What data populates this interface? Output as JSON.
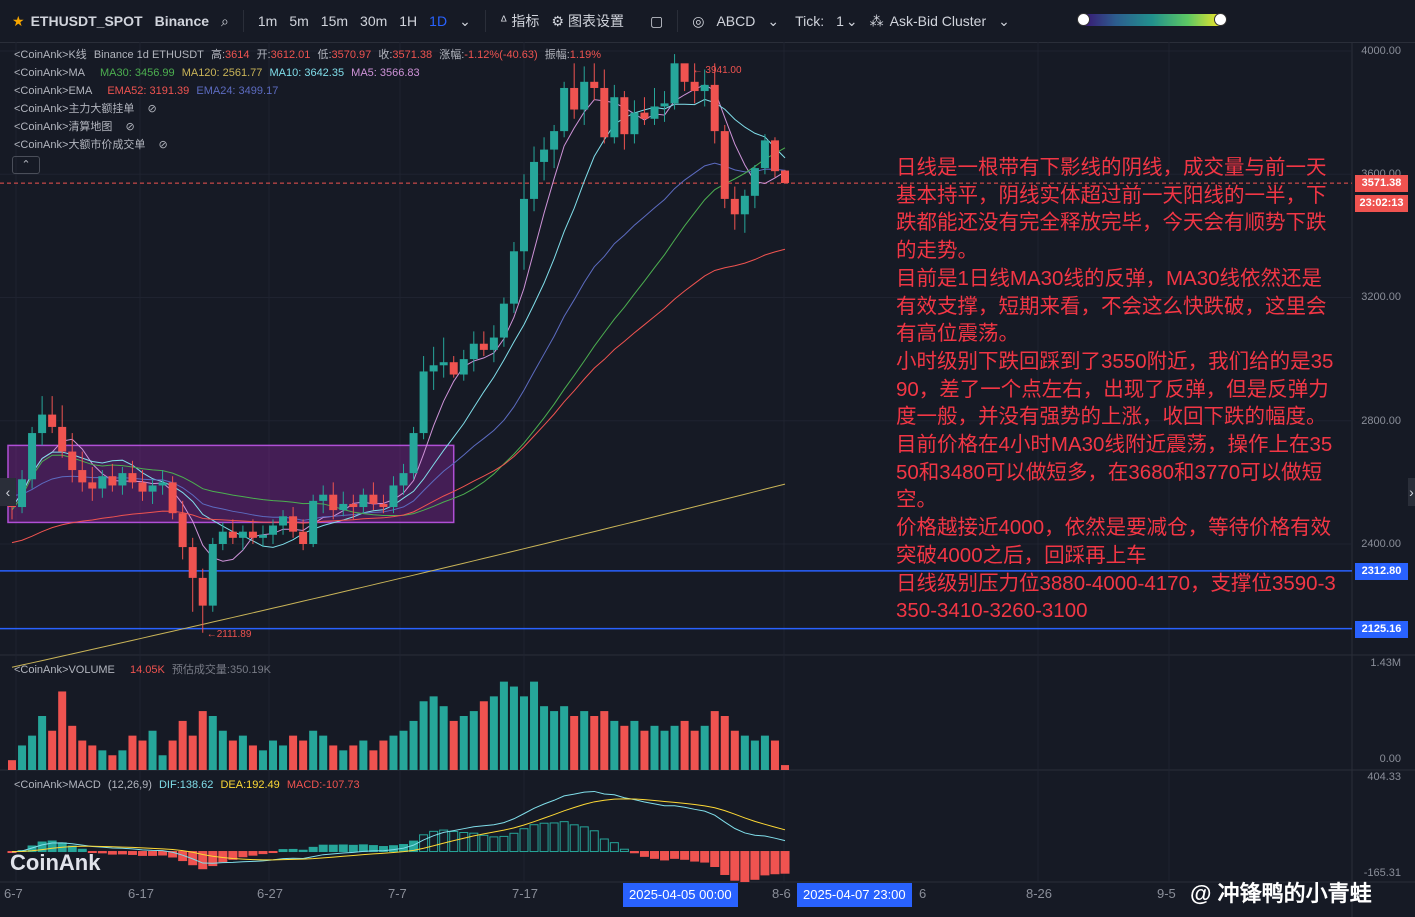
{
  "toolbar": {
    "symbol": "ETHUSDT_SPOT",
    "exchange": "Binance",
    "intervals": [
      "1m",
      "5m",
      "15m",
      "30m",
      "1H",
      "1D"
    ],
    "selected_interval": "1D",
    "indicators_label": "指标",
    "chart_settings_label": "图表设置",
    "abcd_label": "ABCD",
    "tick_label": "Tick:",
    "tick_value": "1",
    "cluster_label": "Ask-Bid Cluster"
  },
  "legend": {
    "kline": {
      "source": "<CoinAnk>",
      "name": "K线",
      "info": "Binance 1d ETHUSDT",
      "high_label": "高:",
      "high": "3614",
      "open_label": "开:",
      "open": "3612.01",
      "low_label": "低:",
      "low": "3570.97",
      "close_label": "收:",
      "close": "3571.38",
      "change_label": "涨幅:",
      "change": "-1.12%(-40.63)",
      "amp_label": "振幅:",
      "amp": "1.19%"
    },
    "ma": {
      "source": "<CoinAnk>",
      "name": "MA",
      "ma30": "MA30: 3456.99",
      "ma120": "MA120: 2561.77",
      "ma10": "MA10: 3642.35",
      "ma5": "MA5: 3566.83"
    },
    "ema": {
      "source": "<CoinAnk>",
      "name": "EMA",
      "ema52": "EMA52: 3191.39",
      "ema24": "EMA24: 3499.17"
    },
    "extra1": {
      "source": "<CoinAnk>",
      "name": "主力大额挂单"
    },
    "extra2": {
      "source": "<CoinAnk>",
      "name": "清算地图"
    },
    "extra3": {
      "source": "<CoinAnk>",
      "name": "大额市价成交单"
    },
    "volume": {
      "source": "<CoinAnk>",
      "name": "VOLUME",
      "value": "14.05K",
      "pred": "预估成交量:350.19K"
    },
    "macd": {
      "source": "<CoinAnk>",
      "name": "MACD",
      "params": "(12,26,9)",
      "dif": "DIF:138.62",
      "dea": "DEA:192.49",
      "macd": "MACD:-107.73"
    }
  },
  "annotation": [
    "日线是一根带有下影线的阴线，成交量与前一天基本持平，阴线实体超过前一天阳线的一半，下跌都能还没有完全释放完毕，今天会有顺势下跌的走势。",
    "目前是1日线MA30线的反弹，MA30线依然还是有效支撑，短期来看，不会这么快跌破，这里会有高位震荡。",
    "小时级别下跌回踩到了3550附近，我们给的是3590，差了一个点左右，出现了反弹，但是反弹力度一般，并没有强势的上涨，收回下跌的幅度。",
    "目前价格在4小时MA30线附近震荡，操作上在3550和3480可以做短多，在3680和3770可以做短空。",
    "价格越接近4000，依然是要减仓，等待价格有效突破4000之后，回踩再上车",
    "日线级别压力位3880-4000-4170，支撑位3590-3350-3410-3260-3100"
  ],
  "price_axis": {
    "ticks": [
      "4000.00",
      "3600.00",
      "3200.00",
      "2800.00",
      "2400.00"
    ],
    "last_price": "3571.38",
    "countdown": "23:02:13",
    "line1": "2312.80",
    "line2": "2125.16",
    "high_mark": "3941.00",
    "low_mark": "2111.89"
  },
  "volume_axis": {
    "top": "1.43M",
    "bottom": "0.00"
  },
  "macd_axis": {
    "top": "404.33",
    "bottom": "-165.31"
  },
  "time_axis": {
    "labels": [
      "6-7",
      "6-17",
      "6-27",
      "7-7",
      "7-17",
      "8-6",
      "8-26",
      "9-5"
    ],
    "cross_label1": "2025-04-05 00:00",
    "cross_label2": "2025-04-07 23:00",
    "extra": "6"
  },
  "logo": "CoinAnk",
  "watermark": "@ 冲锋鸭的小青蛙",
  "colors": {
    "up": "#26a69a",
    "down": "#ef5350",
    "bg": "#161a25",
    "zone": "#9c27b0",
    "hline": "#2962ff"
  },
  "chart_data": {
    "type": "candlestick",
    "ylim": [
      2000,
      4050
    ],
    "candles": [
      [
        2530,
        2580,
        2480,
        2520
      ],
      [
        2520,
        2640,
        2500,
        2610
      ],
      [
        2610,
        2780,
        2580,
        2760
      ],
      [
        2760,
        2880,
        2720,
        2820
      ],
      [
        2820,
        2880,
        2760,
        2780
      ],
      [
        2780,
        2850,
        2680,
        2700
      ],
      [
        2700,
        2760,
        2600,
        2640
      ],
      [
        2640,
        2700,
        2570,
        2600
      ],
      [
        2600,
        2650,
        2540,
        2580
      ],
      [
        2580,
        2640,
        2550,
        2620
      ],
      [
        2620,
        2660,
        2570,
        2590
      ],
      [
        2590,
        2650,
        2560,
        2630
      ],
      [
        2630,
        2670,
        2580,
        2600
      ],
      [
        2600,
        2640,
        2540,
        2570
      ],
      [
        2570,
        2610,
        2530,
        2590
      ],
      [
        2590,
        2640,
        2560,
        2600
      ],
      [
        2600,
        2620,
        2480,
        2500
      ],
      [
        2500,
        2540,
        2350,
        2390
      ],
      [
        2390,
        2420,
        2180,
        2290
      ],
      [
        2290,
        2320,
        2111.89,
        2200
      ],
      [
        2200,
        2420,
        2180,
        2400
      ],
      [
        2400,
        2470,
        2380,
        2440
      ],
      [
        2440,
        2480,
        2400,
        2420
      ],
      [
        2420,
        2460,
        2380,
        2440
      ],
      [
        2440,
        2480,
        2400,
        2420
      ],
      [
        2420,
        2460,
        2390,
        2430
      ],
      [
        2430,
        2480,
        2400,
        2460
      ],
      [
        2460,
        2510,
        2430,
        2490
      ],
      [
        2490,
        2520,
        2420,
        2440
      ],
      [
        2440,
        2480,
        2380,
        2400
      ],
      [
        2400,
        2560,
        2390,
        2540
      ],
      [
        2540,
        2590,
        2500,
        2560
      ],
      [
        2560,
        2600,
        2480,
        2510
      ],
      [
        2510,
        2570,
        2490,
        2530
      ],
      [
        2530,
        2560,
        2480,
        2520
      ],
      [
        2520,
        2580,
        2500,
        2560
      ],
      [
        2560,
        2600,
        2510,
        2530
      ],
      [
        2530,
        2560,
        2500,
        2520
      ],
      [
        2520,
        2620,
        2500,
        2590
      ],
      [
        2590,
        2660,
        2560,
        2630
      ],
      [
        2630,
        2780,
        2610,
        2760
      ],
      [
        2760,
        3010,
        2740,
        2960
      ],
      [
        2960,
        3040,
        2900,
        2980
      ],
      [
        2980,
        3070,
        2940,
        2990
      ],
      [
        2990,
        3010,
        2940,
        2950
      ],
      [
        2950,
        3030,
        2930,
        3000
      ],
      [
        3000,
        3090,
        2960,
        3050
      ],
      [
        3050,
        3090,
        3010,
        3030
      ],
      [
        3030,
        3110,
        2990,
        3070
      ],
      [
        3070,
        3200,
        3040,
        3180
      ],
      [
        3180,
        3380,
        3150,
        3350
      ],
      [
        3350,
        3600,
        3290,
        3520
      ],
      [
        3520,
        3690,
        3480,
        3640
      ],
      [
        3640,
        3720,
        3580,
        3680
      ],
      [
        3680,
        3760,
        3620,
        3740
      ],
      [
        3740,
        3900,
        3720,
        3880
      ],
      [
        3880,
        3960,
        3780,
        3810
      ],
      [
        3810,
        3950,
        3760,
        3900
      ],
      [
        3900,
        3960,
        3840,
        3880
      ],
      [
        3880,
        3940,
        3700,
        3720
      ],
      [
        3720,
        3890,
        3700,
        3850
      ],
      [
        3850,
        3870,
        3680,
        3730
      ],
      [
        3730,
        3840,
        3700,
        3800
      ],
      [
        3800,
        3850,
        3760,
        3780
      ],
      [
        3780,
        3880,
        3760,
        3820
      ],
      [
        3820,
        3870,
        3770,
        3830
      ],
      [
        3830,
        3990,
        3810,
        3960
      ],
      [
        3960,
        3941,
        3870,
        3900
      ],
      [
        3900,
        3960,
        3830,
        3870
      ],
      [
        3870,
        3940,
        3820,
        3890
      ],
      [
        3890,
        3960,
        3700,
        3740
      ],
      [
        3740,
        3760,
        3490,
        3520
      ],
      [
        3520,
        3560,
        3420,
        3470
      ],
      [
        3470,
        3550,
        3410,
        3530
      ],
      [
        3530,
        3630,
        3490,
        3620
      ],
      [
        3620,
        3730,
        3600,
        3710
      ],
      [
        3710,
        3720,
        3590,
        3610
      ],
      [
        3612.01,
        3614,
        3570.97,
        3571.38
      ]
    ],
    "volume": [
      0.1,
      0.25,
      0.35,
      0.55,
      0.4,
      0.8,
      0.45,
      0.3,
      0.25,
      0.2,
      0.15,
      0.2,
      0.35,
      0.3,
      0.4,
      0.15,
      0.3,
      0.5,
      0.35,
      0.6,
      0.55,
      0.4,
      0.3,
      0.35,
      0.25,
      0.2,
      0.3,
      0.25,
      0.35,
      0.3,
      0.4,
      0.35,
      0.25,
      0.2,
      0.25,
      0.3,
      0.2,
      0.3,
      0.35,
      0.4,
      0.5,
      0.7,
      0.75,
      0.65,
      0.5,
      0.55,
      0.6,
      0.7,
      0.75,
      0.9,
      0.85,
      0.75,
      0.9,
      0.65,
      0.6,
      0.65,
      0.55,
      0.6,
      0.55,
      0.6,
      0.5,
      0.45,
      0.5,
      0.4,
      0.45,
      0.4,
      0.45,
      0.5,
      0.4,
      0.45,
      0.6,
      0.55,
      0.4,
      0.35,
      0.3,
      0.35,
      0.3,
      0.05
    ],
    "volume_ylim": [
      0,
      1.43
    ],
    "macd_ylim": [
      -165.31,
      404.33
    ],
    "hlines": [
      2312.8,
      2125.16
    ],
    "zone": {
      "from_index": 0,
      "to_index": 44,
      "low": 2470,
      "high": 2720
    }
  }
}
